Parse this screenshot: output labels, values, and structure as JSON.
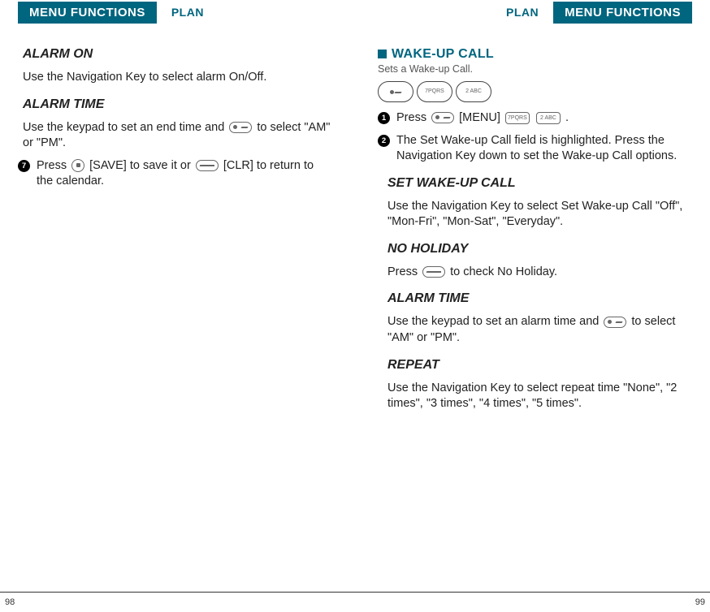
{
  "header": {
    "menu_functions": "MENU FUNCTIONS",
    "plan": "PLAN"
  },
  "left_page": {
    "alarm_on": {
      "heading": "ALARM ON",
      "body": "Use the Navigation Key to select alarm On/Off."
    },
    "alarm_time": {
      "heading": "ALARM TIME",
      "body_pre": "Use the keypad to set an end time and ",
      "body_post": " to select \"AM\" or \"PM\"."
    },
    "step7": {
      "num": "7",
      "pre": "Press ",
      "mid1": " [SAVE] to save it or ",
      "mid2": " [CLR] to return to the calendar."
    },
    "page_num": "98"
  },
  "right_page": {
    "wakeup": {
      "title": "WAKE-UP CALL",
      "sub": "Sets a Wake-up Call."
    },
    "key7_label": "7PQRS",
    "key2_label": "2 ABC",
    "step1": {
      "num": "1",
      "pre": "Press ",
      "mid": " [MENU] ",
      "post": " ."
    },
    "step2": {
      "num": "2",
      "text": "The Set Wake-up Call field is highlighted. Press the Navigation Key down to set the Wake-up Call options."
    },
    "set_wakeup": {
      "heading": "SET WAKE-UP CALL",
      "body": "Use the Navigation Key to select Set Wake-up Call \"Off\",  \"Mon-Fri\", \"Mon-Sat\", \"Everyday\"."
    },
    "no_holiday": {
      "heading": "NO HOLIDAY",
      "body_pre": "Press ",
      "body_post": " to check No Holiday."
    },
    "alarm_time": {
      "heading": "ALARM TIME",
      "body_pre": "Use the keypad to set an alarm time and ",
      "body_post": " to select \"AM\" or \"PM\"."
    },
    "repeat": {
      "heading": "REPEAT",
      "body": "Use the Navigation Key to select repeat time \"None\", \"2 times\", \"3 times\", \"4 times\", \"5 times\"."
    },
    "page_num": "99"
  }
}
